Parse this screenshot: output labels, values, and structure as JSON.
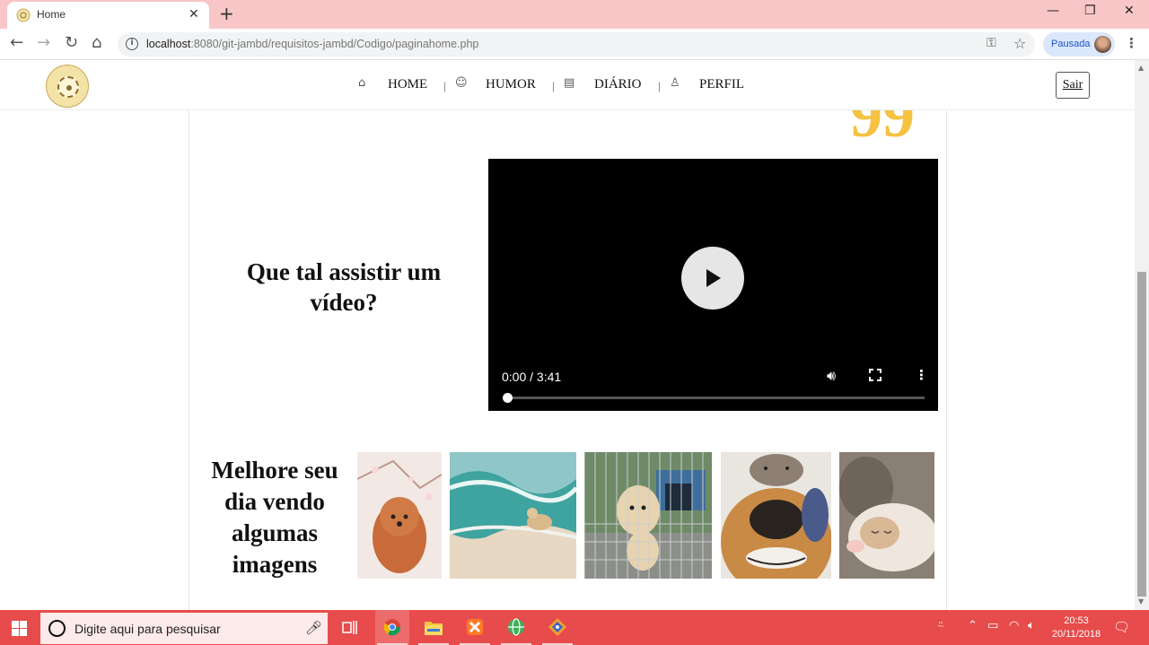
{
  "browser": {
    "tab_title": "Home",
    "tab_close": "✕",
    "new_tab": "+",
    "url_host": "localhost",
    "url_rest": ":8080/git-jambd/requisitos-jambd/Codigo/paginahome.php",
    "profile_label": "Pausada",
    "window_controls": {
      "minimize": "—",
      "restore": "❐",
      "close": "✕"
    },
    "nav": {
      "back": "←",
      "forward": "→",
      "reload": "↻",
      "home": "⌂"
    }
  },
  "header": {
    "nav_items": [
      {
        "label": "HOME",
        "icon": "home-icon",
        "glyph": "⌂"
      },
      {
        "label": "HUMOR",
        "icon": "smile-icon",
        "glyph": "☺"
      },
      {
        "label": "DIÁRIO",
        "icon": "book-icon",
        "glyph": "▤"
      },
      {
        "label": "PERFIL",
        "icon": "user-icon",
        "glyph": "♙"
      }
    ],
    "separator": "|",
    "logout_label": "Sair"
  },
  "main": {
    "quote_glyph": "99",
    "video_title": "Que tal assistir um vídeo?",
    "video": {
      "time": "0:00 / 3:41",
      "progress": 0
    },
    "images_title": "Melhore seu dia vendo algumas imagens",
    "images": [
      {
        "name": "poodle-puppy-photo",
        "colors": [
          "#f3e9e4",
          "#c86a3a",
          "#d9b8a8"
        ]
      },
      {
        "name": "dog-in-waves-photo",
        "colors": [
          "#8fc7c8",
          "#3fa39f",
          "#e6d8c3"
        ]
      },
      {
        "name": "golden-puppies-in-fence-photo",
        "colors": [
          "#6f8a67",
          "#e7d3b0",
          "#3e6f9c"
        ]
      },
      {
        "name": "dog-and-cat-selfie-photo",
        "colors": [
          "#e9e6df",
          "#c98a45",
          "#2a2420"
        ]
      },
      {
        "name": "sleeping-cat-photo",
        "colors": [
          "#8a7f74",
          "#efe7de",
          "#c9a98c"
        ]
      }
    ]
  },
  "taskbar": {
    "search_placeholder": "Digite aqui para pesquisar",
    "time": "20:53",
    "date": "20/11/2018"
  },
  "colors": {
    "tab_bar": "#f8c6c6",
    "taskbar": "#e84b4b",
    "quote_accent": "#f5c242"
  }
}
